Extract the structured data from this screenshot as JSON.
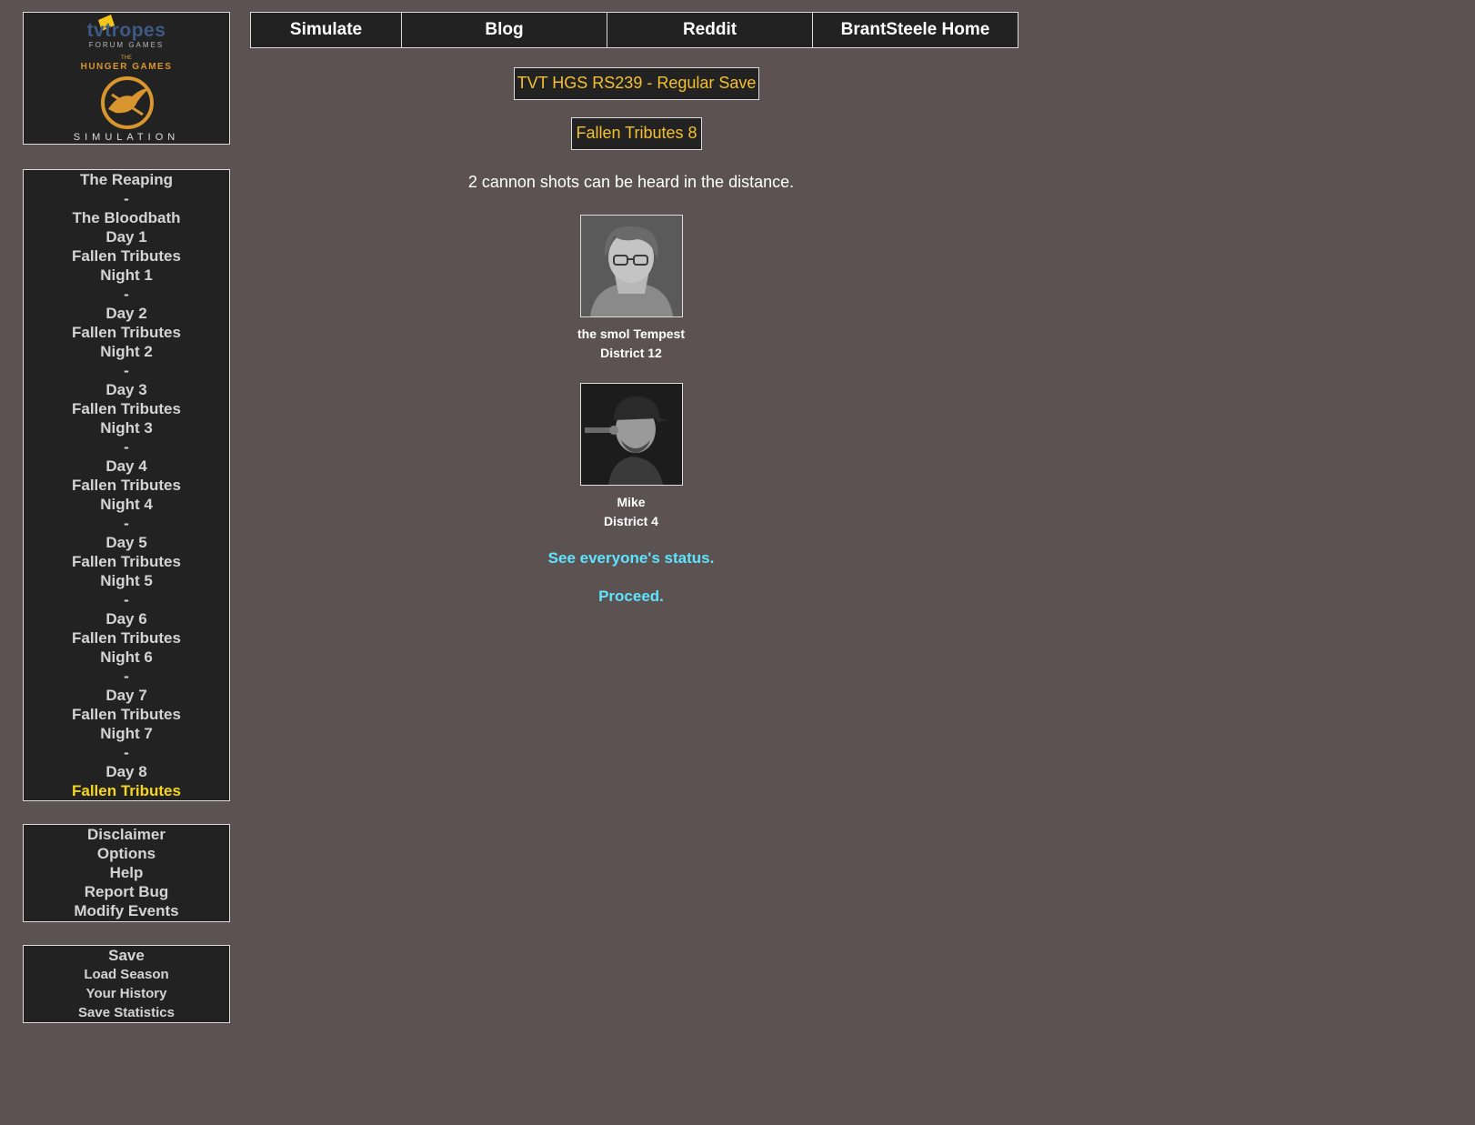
{
  "logo": {
    "brand": "tvtropes",
    "subtitle": "FORUM GAMES",
    "the": "THE",
    "title": "HUNGER GAMES",
    "simulation": "SIMULATION"
  },
  "topnav": {
    "items": [
      "Simulate",
      "Blog",
      "Reddit",
      "BrantSteele Home"
    ]
  },
  "nav_days": {
    "items": [
      "The Reaping",
      "-",
      "The Bloodbath",
      "Day 1",
      "Fallen Tributes",
      "Night 1",
      "-",
      "Day 2",
      "Fallen Tributes",
      "Night 2",
      "-",
      "Day 3",
      "Fallen Tributes",
      "Night 3",
      "-",
      "Day 4",
      "Fallen Tributes",
      "Night 4",
      "-",
      "Day 5",
      "Fallen Tributes",
      "Night 5",
      "-",
      "Day 6",
      "Fallen Tributes",
      "Night 6",
      "-",
      "Day 7",
      "Fallen Tributes",
      "Night 7",
      "-",
      "Day 8",
      "Fallen Tributes"
    ],
    "current_index": 32
  },
  "nav_misc": {
    "items": [
      "Disclaimer",
      "Options",
      "Help",
      "Report Bug",
      "Modify Events"
    ]
  },
  "nav_save": {
    "items": [
      "Save",
      "Load Season",
      "Your History",
      "Save Statistics"
    ]
  },
  "main": {
    "save_title": "TVT HGS RS239 - Regular Save",
    "phase_title": "Fallen Tributes 8",
    "cannon_text": "2 cannon shots can be heard in the distance.",
    "tributes": [
      {
        "name": "the smol Tempest",
        "district": "District 12"
      },
      {
        "name": "Mike",
        "district": "District 4"
      }
    ],
    "see_status": "See everyone's status.",
    "proceed": "Proceed."
  },
  "colors": {
    "background": "#5d5252",
    "panel": "#222222",
    "title_text": "#f5c030",
    "current_item": "#f5d51f",
    "link": "#5fe3ff"
  }
}
